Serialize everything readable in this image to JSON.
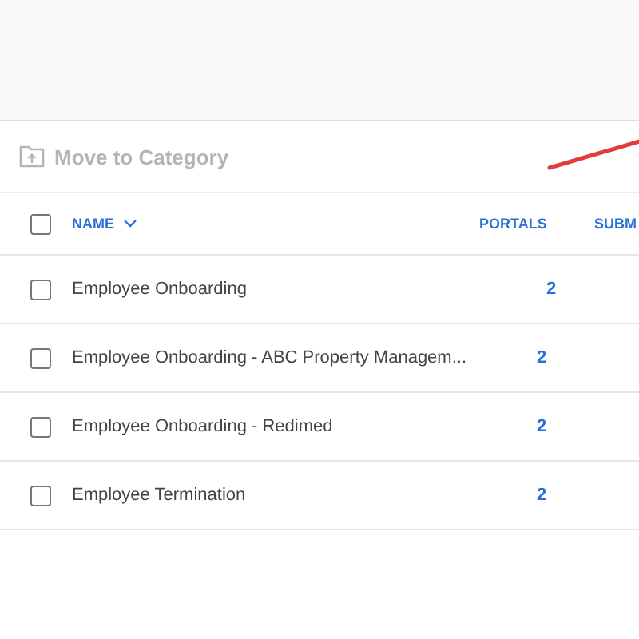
{
  "toolbar": {
    "action": "Move to Category",
    "disabled": true
  },
  "table": {
    "select_all": {
      "checked": false
    },
    "columns": [
      {
        "label": "NAME",
        "sorted": true
      },
      {
        "label": "PORTALS"
      },
      {
        "label": "SUBM"
      }
    ],
    "rows": [
      {
        "name": "Employee Onboarding",
        "portals": "2",
        "checked": false
      },
      {
        "name": "Employee Onboarding - ABC Property Managem...",
        "portals": "2",
        "checked": false
      },
      {
        "name": "Employee Onboarding - Redimed",
        "portals": "2",
        "checked": false
      },
      {
        "name": "Employee Termination",
        "portals": "2",
        "checked": false
      }
    ]
  }
}
